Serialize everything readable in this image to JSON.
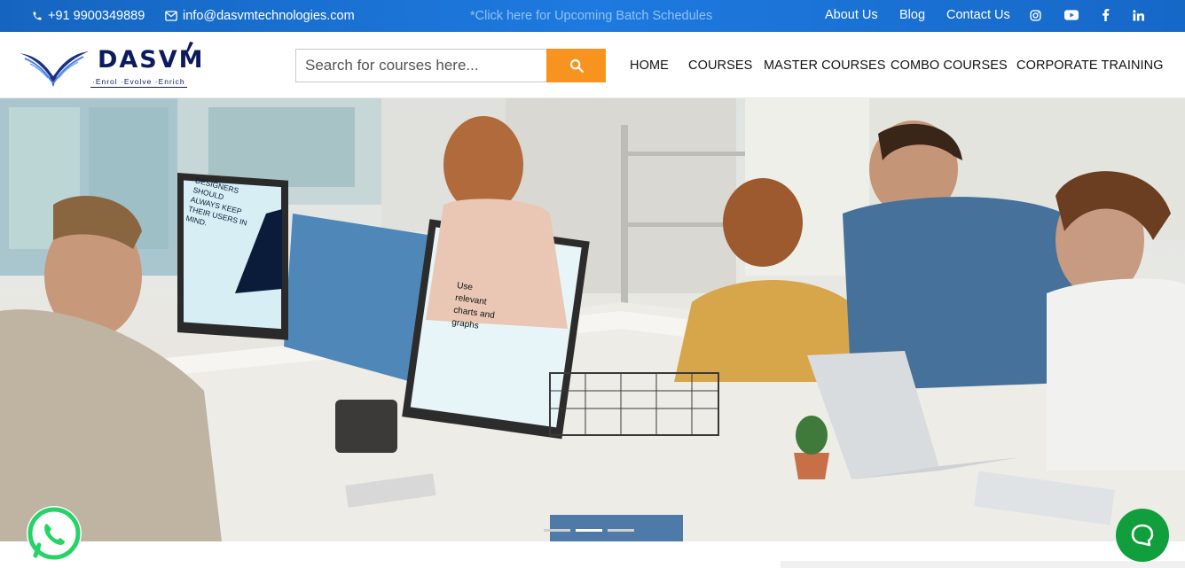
{
  "topbar": {
    "phone": "+91 9900349889",
    "email": "info@dasvmtechnologies.com",
    "schedule_link": "*Click here for Upcoming Batch Schedules",
    "links": [
      "About Us",
      "Blog",
      "Contact Us"
    ],
    "social_icons": [
      "instagram-icon",
      "youtube-icon",
      "facebook-icon",
      "linkedin-icon"
    ]
  },
  "header": {
    "logo_text": "DASVM",
    "logo_tagline": "·Enrol ·Evolve ·Enrich",
    "search_placeholder": "Search for courses here...",
    "nav": [
      "HOME",
      "COURSES",
      "MASTER COURSES",
      "COMBO COURSES",
      "CORPORATE TRAINING"
    ]
  },
  "hero": {
    "screen1_text": "DESIGNERS SHOULD ALWAYS KEEP THEIR USERS IN MIND.",
    "screen2_text": "Use relevant charts and graphs",
    "slides": 3,
    "active_slide": 2
  },
  "colors": {
    "topbar": "#1e7ae0",
    "accent": "#f7931e",
    "chat": "#109f3c",
    "whatsapp": "#25d366",
    "brand": "#0d1b5e"
  }
}
